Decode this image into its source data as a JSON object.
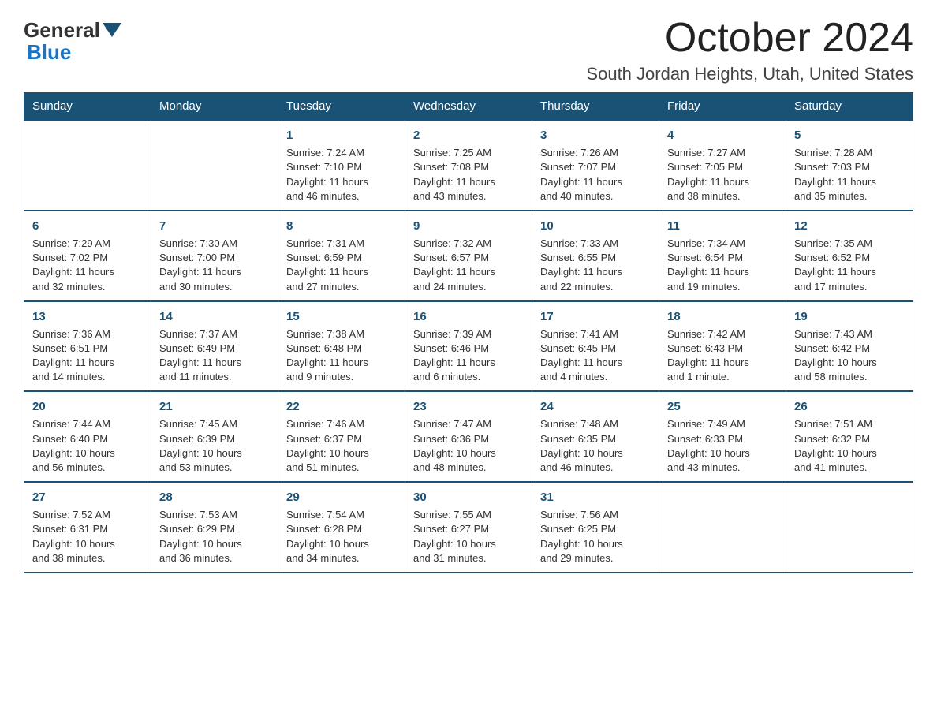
{
  "header": {
    "logo_text_general": "General",
    "logo_text_blue": "Blue",
    "month_title": "October 2024",
    "location": "South Jordan Heights, Utah, United States"
  },
  "weekdays": [
    "Sunday",
    "Monday",
    "Tuesday",
    "Wednesday",
    "Thursday",
    "Friday",
    "Saturday"
  ],
  "weeks": [
    [
      {
        "day": "",
        "info": ""
      },
      {
        "day": "",
        "info": ""
      },
      {
        "day": "1",
        "info": "Sunrise: 7:24 AM\nSunset: 7:10 PM\nDaylight: 11 hours\nand 46 minutes."
      },
      {
        "day": "2",
        "info": "Sunrise: 7:25 AM\nSunset: 7:08 PM\nDaylight: 11 hours\nand 43 minutes."
      },
      {
        "day": "3",
        "info": "Sunrise: 7:26 AM\nSunset: 7:07 PM\nDaylight: 11 hours\nand 40 minutes."
      },
      {
        "day": "4",
        "info": "Sunrise: 7:27 AM\nSunset: 7:05 PM\nDaylight: 11 hours\nand 38 minutes."
      },
      {
        "day": "5",
        "info": "Sunrise: 7:28 AM\nSunset: 7:03 PM\nDaylight: 11 hours\nand 35 minutes."
      }
    ],
    [
      {
        "day": "6",
        "info": "Sunrise: 7:29 AM\nSunset: 7:02 PM\nDaylight: 11 hours\nand 32 minutes."
      },
      {
        "day": "7",
        "info": "Sunrise: 7:30 AM\nSunset: 7:00 PM\nDaylight: 11 hours\nand 30 minutes."
      },
      {
        "day": "8",
        "info": "Sunrise: 7:31 AM\nSunset: 6:59 PM\nDaylight: 11 hours\nand 27 minutes."
      },
      {
        "day": "9",
        "info": "Sunrise: 7:32 AM\nSunset: 6:57 PM\nDaylight: 11 hours\nand 24 minutes."
      },
      {
        "day": "10",
        "info": "Sunrise: 7:33 AM\nSunset: 6:55 PM\nDaylight: 11 hours\nand 22 minutes."
      },
      {
        "day": "11",
        "info": "Sunrise: 7:34 AM\nSunset: 6:54 PM\nDaylight: 11 hours\nand 19 minutes."
      },
      {
        "day": "12",
        "info": "Sunrise: 7:35 AM\nSunset: 6:52 PM\nDaylight: 11 hours\nand 17 minutes."
      }
    ],
    [
      {
        "day": "13",
        "info": "Sunrise: 7:36 AM\nSunset: 6:51 PM\nDaylight: 11 hours\nand 14 minutes."
      },
      {
        "day": "14",
        "info": "Sunrise: 7:37 AM\nSunset: 6:49 PM\nDaylight: 11 hours\nand 11 minutes."
      },
      {
        "day": "15",
        "info": "Sunrise: 7:38 AM\nSunset: 6:48 PM\nDaylight: 11 hours\nand 9 minutes."
      },
      {
        "day": "16",
        "info": "Sunrise: 7:39 AM\nSunset: 6:46 PM\nDaylight: 11 hours\nand 6 minutes."
      },
      {
        "day": "17",
        "info": "Sunrise: 7:41 AM\nSunset: 6:45 PM\nDaylight: 11 hours\nand 4 minutes."
      },
      {
        "day": "18",
        "info": "Sunrise: 7:42 AM\nSunset: 6:43 PM\nDaylight: 11 hours\nand 1 minute."
      },
      {
        "day": "19",
        "info": "Sunrise: 7:43 AM\nSunset: 6:42 PM\nDaylight: 10 hours\nand 58 minutes."
      }
    ],
    [
      {
        "day": "20",
        "info": "Sunrise: 7:44 AM\nSunset: 6:40 PM\nDaylight: 10 hours\nand 56 minutes."
      },
      {
        "day": "21",
        "info": "Sunrise: 7:45 AM\nSunset: 6:39 PM\nDaylight: 10 hours\nand 53 minutes."
      },
      {
        "day": "22",
        "info": "Sunrise: 7:46 AM\nSunset: 6:37 PM\nDaylight: 10 hours\nand 51 minutes."
      },
      {
        "day": "23",
        "info": "Sunrise: 7:47 AM\nSunset: 6:36 PM\nDaylight: 10 hours\nand 48 minutes."
      },
      {
        "day": "24",
        "info": "Sunrise: 7:48 AM\nSunset: 6:35 PM\nDaylight: 10 hours\nand 46 minutes."
      },
      {
        "day": "25",
        "info": "Sunrise: 7:49 AM\nSunset: 6:33 PM\nDaylight: 10 hours\nand 43 minutes."
      },
      {
        "day": "26",
        "info": "Sunrise: 7:51 AM\nSunset: 6:32 PM\nDaylight: 10 hours\nand 41 minutes."
      }
    ],
    [
      {
        "day": "27",
        "info": "Sunrise: 7:52 AM\nSunset: 6:31 PM\nDaylight: 10 hours\nand 38 minutes."
      },
      {
        "day": "28",
        "info": "Sunrise: 7:53 AM\nSunset: 6:29 PM\nDaylight: 10 hours\nand 36 minutes."
      },
      {
        "day": "29",
        "info": "Sunrise: 7:54 AM\nSunset: 6:28 PM\nDaylight: 10 hours\nand 34 minutes."
      },
      {
        "day": "30",
        "info": "Sunrise: 7:55 AM\nSunset: 6:27 PM\nDaylight: 10 hours\nand 31 minutes."
      },
      {
        "day": "31",
        "info": "Sunrise: 7:56 AM\nSunset: 6:25 PM\nDaylight: 10 hours\nand 29 minutes."
      },
      {
        "day": "",
        "info": ""
      },
      {
        "day": "",
        "info": ""
      }
    ]
  ]
}
